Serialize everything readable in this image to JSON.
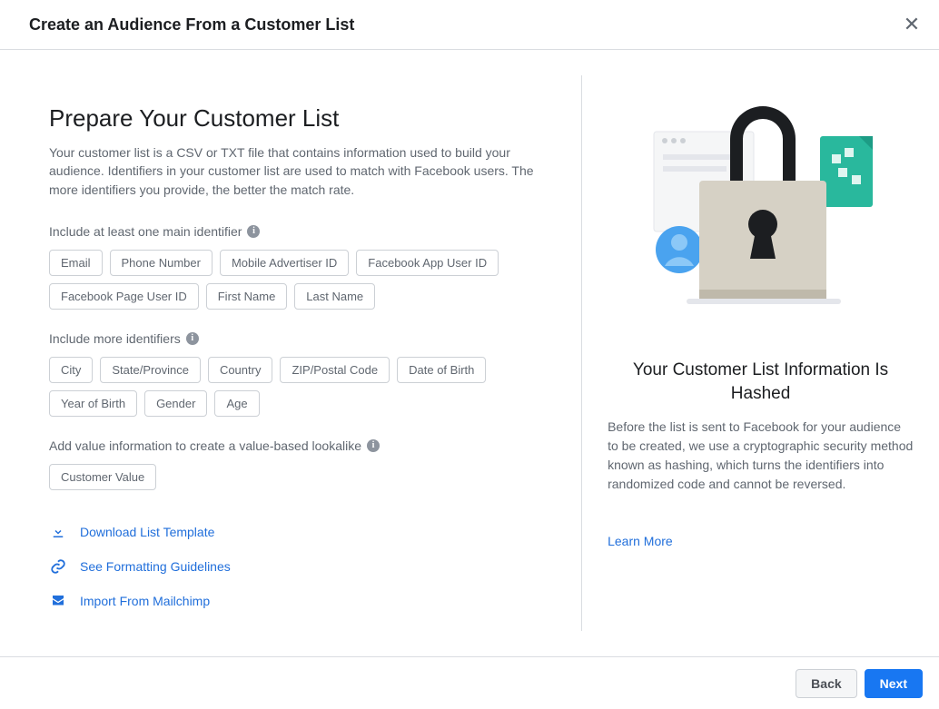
{
  "header": {
    "title": "Create an Audience From a Customer List"
  },
  "left": {
    "heading": "Prepare Your Customer List",
    "description": "Your customer list is a CSV or TXT file that contains information used to build your audience. Identifiers in your customer list are used to match with Facebook users. The more identifiers you provide, the better the match rate.",
    "main_identifiers": {
      "title": "Include at least one main identifier",
      "items": [
        "Email",
        "Phone Number",
        "Mobile Advertiser ID",
        "Facebook App User ID",
        "Facebook Page User ID",
        "First Name",
        "Last Name"
      ]
    },
    "more_identifiers": {
      "title": "Include more identifiers",
      "items": [
        "City",
        "State/Province",
        "Country",
        "ZIP/Postal Code",
        "Date of Birth",
        "Year of Birth",
        "Gender",
        "Age"
      ]
    },
    "value_section": {
      "title": "Add value information to create a value-based lookalike",
      "items": [
        "Customer Value"
      ]
    },
    "actions": {
      "download": "Download List Template",
      "guidelines": "See Formatting Guidelines",
      "mailchimp": "Import From Mailchimp"
    }
  },
  "right": {
    "heading": "Your Customer List Information Is Hashed",
    "text": "Before the list is sent to Facebook for your audience to be created, we use a cryptographic security method known as hashing, which turns the identifiers into randomized code and cannot be reversed.",
    "learn_more": "Learn More"
  },
  "footer": {
    "back": "Back",
    "next": "Next"
  }
}
